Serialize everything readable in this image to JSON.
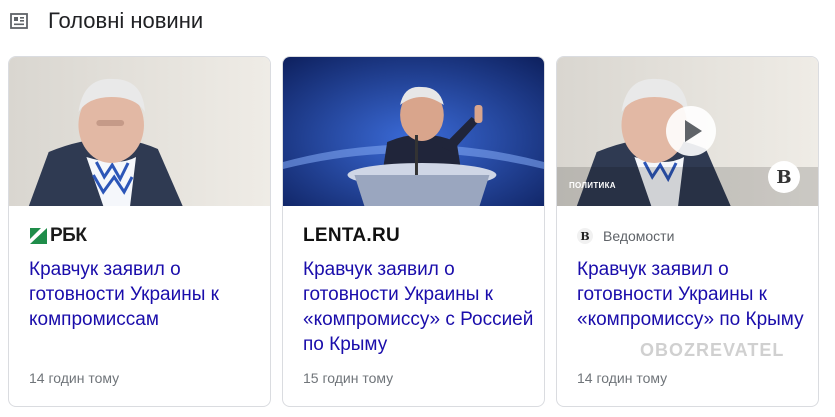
{
  "header": {
    "title": "Головні новини",
    "icon": "newspaper-icon"
  },
  "cards": [
    {
      "source": "РБК",
      "headline": "Кравчук заявил о готовности Украины к компромиссам",
      "time": "14 годин тому"
    },
    {
      "source": "LENTA.RU",
      "headline": "Кравчук заявил о готовности Украины к «компромиссу» с Россией по Крыму",
      "time": "15 годин тому"
    },
    {
      "source": "Ведомости",
      "source_badge": "B",
      "thumb_tag": "ПОЛИТИКА",
      "headline": "Кравчук заявил о готовности Украины к «компромиссу» по Крыму",
      "time": "14 годин тому"
    }
  ],
  "watermark": "OBOZREVATEL",
  "colors": {
    "headline": "#1a0dab",
    "time": "#70757a",
    "border": "#dadce0",
    "rbc_green": "#1f8d4a"
  }
}
